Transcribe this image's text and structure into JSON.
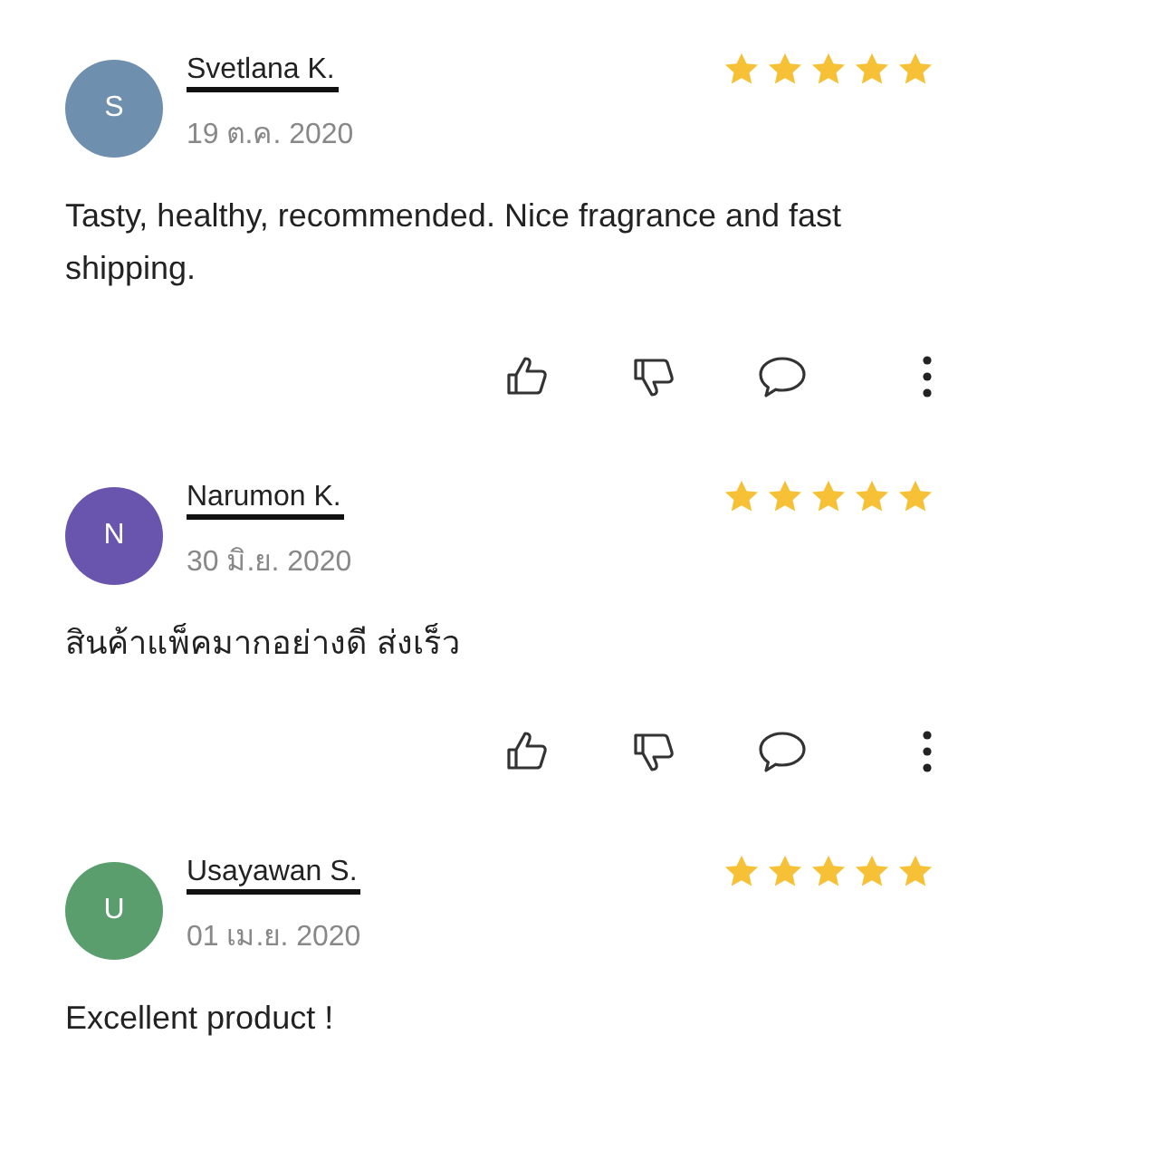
{
  "reviews": [
    {
      "initial": "S",
      "color": "#6f8fae",
      "name": "Svetlana K.",
      "date": "19 ต.ค. 2020",
      "stars": 5,
      "text": "Tasty, healthy, recommended. Nice fragrance and fast shipping."
    },
    {
      "initial": "N",
      "color": "#6a55ae",
      "name": "Narumon K.",
      "date": "30 มิ.ย. 2020",
      "stars": 5,
      "text": "สินค้าแพ็คมากอย่างดี ส่งเร็ว"
    },
    {
      "initial": "U",
      "color": "#5a9e6e",
      "name": "Usayawan S.",
      "date": "01 เม.ย. 2020",
      "stars": 5,
      "text": "Excellent product !"
    }
  ]
}
